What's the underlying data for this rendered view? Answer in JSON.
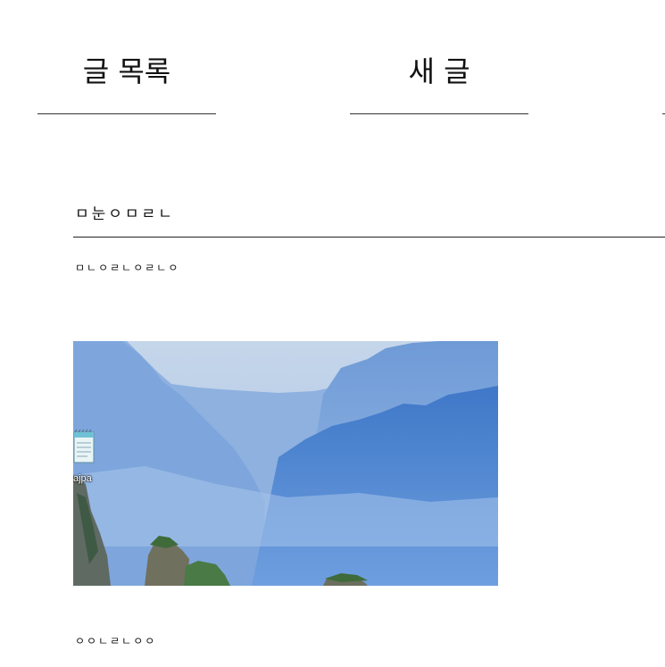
{
  "nav": {
    "list_tab": "글 목록",
    "new_tab": "새 글"
  },
  "post": {
    "title": "ㅁ눈ㅇㅁㄹㄴ",
    "body": "ㅁㄴㅇㄹㄴㅇㄹㄴㅇ",
    "image": {
      "desktop_icon": "notepad-file-icon",
      "desktop_icon_label": "ajpa"
    },
    "footer": "ㅇㅇㄴㄹㄴㅇㅇ"
  },
  "colors": {
    "sky": "#c9d9ec",
    "mountain_far": "#7fa8dc",
    "mountain_near": "#4f86cf",
    "rock": "#6b6f5e",
    "foliage": "#3f6b3a"
  }
}
